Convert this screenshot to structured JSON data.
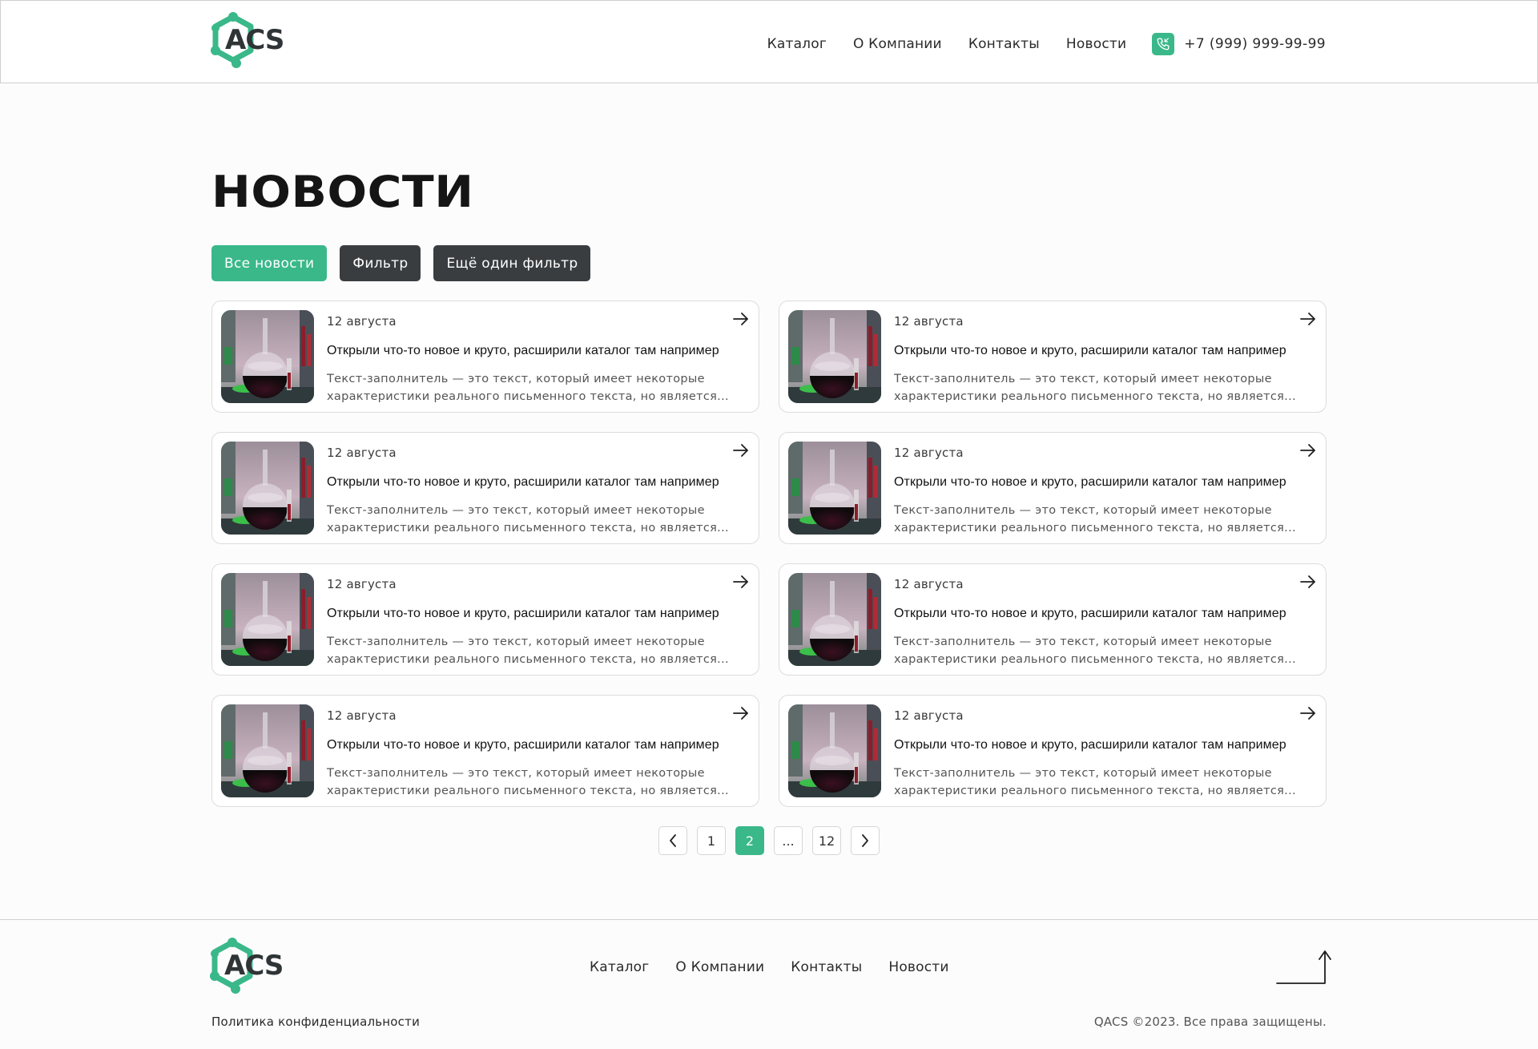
{
  "brand": {
    "name": "ACS",
    "accent_color": "#3ab88a",
    "dark_color": "#3a3d40"
  },
  "header": {
    "nav": [
      "Каталог",
      "О Компании",
      "Контакты",
      "Новости"
    ],
    "phone": "+7 (999) 999-99-99"
  },
  "page": {
    "title": "НОВОСТИ"
  },
  "filters": [
    "Все новости",
    "Фильтр",
    "Ещё один фильтр"
  ],
  "news": [
    {
      "date": "12 августа",
      "title": "Открыли что-то новое и круто, расширили каталог там например",
      "text_line1": "Текст-заполнитель — это текст, который имеет некоторые",
      "text_line2": "характеристики реального письменного текста, но является..."
    },
    {
      "date": "12 августа",
      "title": "Открыли что-то новое и круто, расширили каталог там например",
      "text_line1": "Текст-заполнитель — это текст, который имеет некоторые",
      "text_line2": "характеристики реального письменного текста, но является..."
    },
    {
      "date": "12 августа",
      "title": "Открыли что-то новое и круто, расширили каталог там например",
      "text_line1": "Текст-заполнитель — это текст, который имеет некоторые",
      "text_line2": "характеристики реального письменного текста, но является..."
    },
    {
      "date": "12 августа",
      "title": "Открыли что-то новое и круто, расширили каталог там например",
      "text_line1": "Текст-заполнитель — это текст, который имеет некоторые",
      "text_line2": "характеристики реального письменного текста, но является..."
    },
    {
      "date": "12 августа",
      "title": "Открыли что-то новое и круто, расширили каталог там например",
      "text_line1": "Текст-заполнитель — это текст, который имеет некоторые",
      "text_line2": "характеристики реального письменного текста, но является..."
    },
    {
      "date": "12 августа",
      "title": "Открыли что-то новое и круто, расширили каталог там например",
      "text_line1": "Текст-заполнитель — это текст, который имеет некоторые",
      "text_line2": "характеристики реального письменного текста, но является..."
    },
    {
      "date": "12 августа",
      "title": "Открыли что-то новое и круто, расширили каталог там например",
      "text_line1": "Текст-заполнитель — это текст, который имеет некоторые",
      "text_line2": "характеристики реального письменного текста, но является..."
    },
    {
      "date": "12 августа",
      "title": "Открыли что-то новое и круто, расширили каталог там например",
      "text_line1": "Текст-заполнитель — это текст, который имеет некоторые",
      "text_line2": "характеристики реального письменного текста, но является..."
    }
  ],
  "pagination": {
    "pages": [
      "1",
      "2",
      "...",
      "12"
    ],
    "current": "2"
  },
  "footer": {
    "nav": [
      "Каталог",
      "О Компании",
      "Контакты",
      "Новости"
    ],
    "policy": "Политика конфиденциальности",
    "copyright": "QACS ©2023. Все права защищены."
  }
}
